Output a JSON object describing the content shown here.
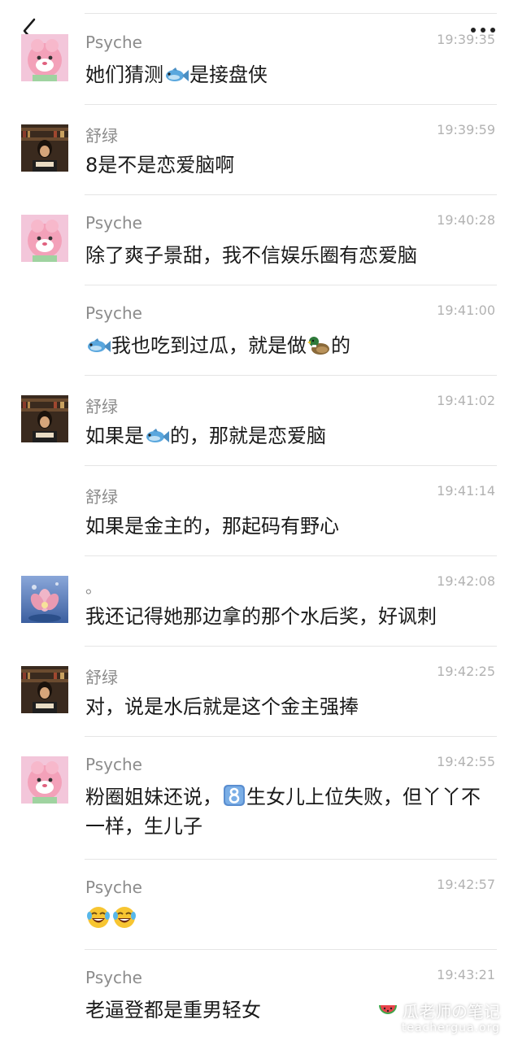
{
  "toolbar": {
    "back_icon": "chevron-left-icon",
    "more_icon": "more-dots-icon"
  },
  "messages": [
    {
      "sender": "Psyche",
      "time": "19:39:35",
      "avatar": "pink-cartoon",
      "text_parts": [
        "她们猜测",
        {
          "emoji": "fish"
        },
        "是接盘侠"
      ]
    },
    {
      "sender": "舒绿",
      "time": "19:39:59",
      "avatar": "library-photo",
      "text_parts": [
        "8是不是恋爱脑啊"
      ]
    },
    {
      "sender": "Psyche",
      "time": "19:40:28",
      "avatar": "pink-cartoon",
      "text_parts": [
        "除了爽子景甜，我不信娱乐圈有恋爱脑"
      ]
    },
    {
      "sender": "Psyche",
      "time": "19:41:00",
      "avatar": "",
      "text_parts": [
        {
          "emoji": "fish"
        },
        "我也吃到过瓜，就是做",
        {
          "emoji": "duck"
        },
        "的"
      ]
    },
    {
      "sender": "舒绿",
      "time": "19:41:02",
      "avatar": "library-photo",
      "text_parts": [
        "如果是",
        {
          "emoji": "fish"
        },
        "的，那就是恋爱脑"
      ]
    },
    {
      "sender": "舒绿",
      "time": "19:41:14",
      "avatar": "",
      "text_parts": [
        "如果是金主的，那起码有野心"
      ]
    },
    {
      "sender": "。",
      "time": "19:42:08",
      "avatar": "flower-painting",
      "text_parts": [
        "我还记得她那边拿的那个水后奖，好讽刺"
      ]
    },
    {
      "sender": "舒绿",
      "time": "19:42:25",
      "avatar": "library-photo",
      "text_parts": [
        "对，说是水后就是这个金主强捧"
      ]
    },
    {
      "sender": "Psyche",
      "time": "19:42:55",
      "avatar": "pink-cartoon",
      "text_parts": [
        "粉圈姐妹还说，",
        {
          "emoji": "keycap-8"
        },
        "生女儿上位失败，但丫丫不一样，生儿子"
      ]
    },
    {
      "sender": "Psyche",
      "time": "19:42:57",
      "avatar": "",
      "text_parts": [
        {
          "emoji": "crying-laughing"
        },
        {
          "emoji": "crying-laughing"
        }
      ]
    },
    {
      "sender": "Psyche",
      "time": "19:43:21",
      "avatar": "",
      "text_parts": [
        "老逼登都是重男轻女"
      ]
    }
  ],
  "watermark": {
    "title": "瓜老师の笔记",
    "subtitle": "teachergua.org",
    "icon": "watermelon-icon"
  }
}
